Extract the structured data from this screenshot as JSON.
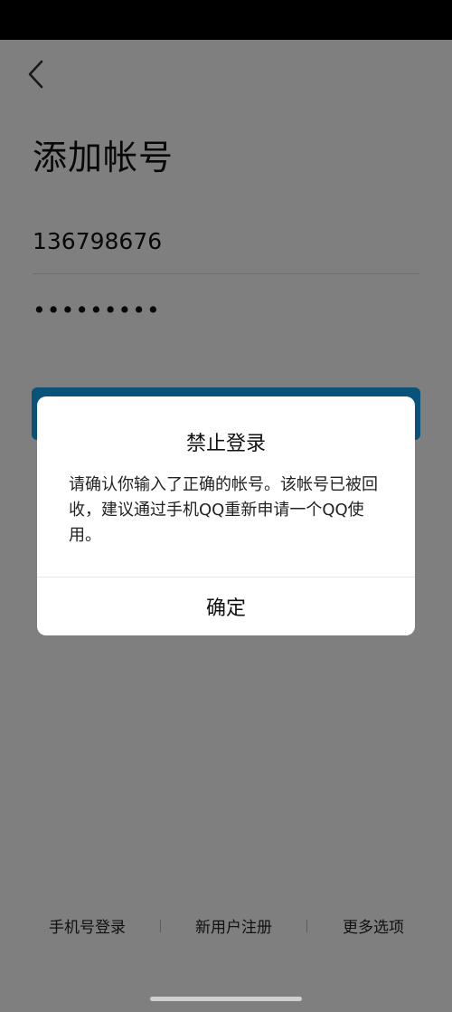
{
  "page": {
    "title": "添加帐号",
    "back_icon": "chevron-left-icon"
  },
  "form": {
    "account_value": "136798676",
    "password_value": "•••••••••",
    "login_button_color": "#12a7f5"
  },
  "bottom_links": {
    "phone_login": "手机号登录",
    "register": "新用户注册",
    "more_options": "更多选项"
  },
  "dialog": {
    "title": "禁止登录",
    "message": "请确认你输入了正确的帐号。该帐号已被回收，建议通过手机QQ重新申请一个QQ使用。",
    "confirm_label": "确定"
  },
  "colors": {
    "overlay": "rgba(0,0,0,0.5)",
    "status_bar": "#000000"
  }
}
